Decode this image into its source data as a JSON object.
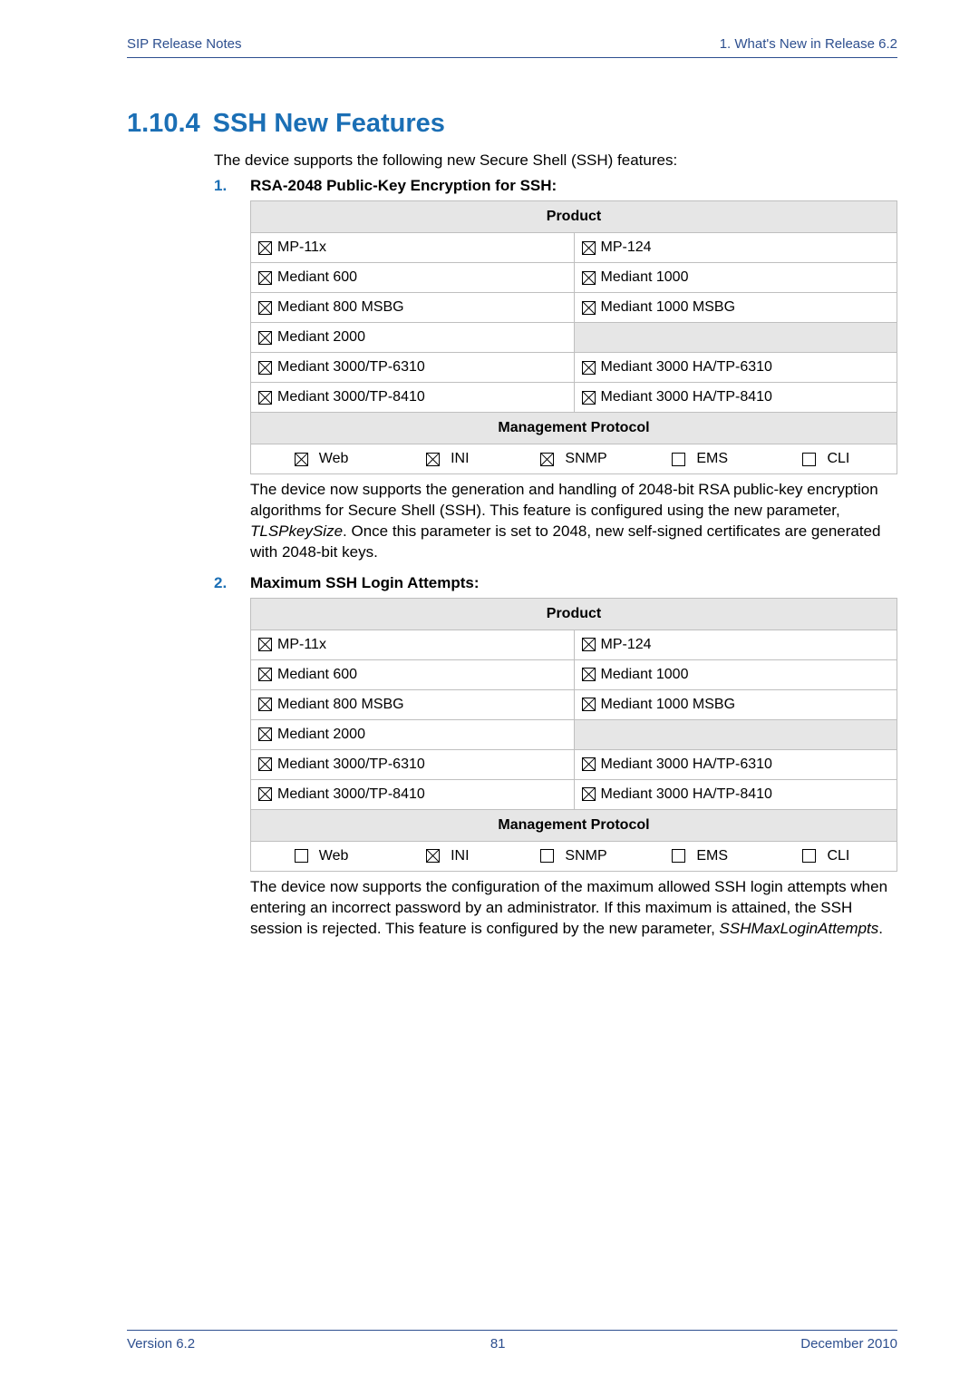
{
  "header": {
    "left": "SIP Release Notes",
    "right": "1. What's New in Release 6.2"
  },
  "section": {
    "number": "1.10.4",
    "title": "SSH New Features",
    "intro": "The device supports the following new Secure Shell (SSH) features:"
  },
  "item1": {
    "num": "1.",
    "title": "RSA-2048 Public-Key Encryption for SSH:",
    "productHeader": "Product",
    "mgmtHeader": "Management Protocol",
    "rows": [
      {
        "l": "MP-11x",
        "lc": true,
        "r": "MP-124",
        "rc": true
      },
      {
        "l": "Mediant 600",
        "lc": true,
        "r": "Mediant 1000",
        "rc": true
      },
      {
        "l": "Mediant 800 MSBG",
        "lc": true,
        "r": "Mediant 1000 MSBG",
        "rc": true
      },
      {
        "l": "Mediant 2000",
        "lc": true,
        "r": "",
        "rc": null
      },
      {
        "l": "Mediant 3000/TP-6310",
        "lc": true,
        "r": "Mediant 3000 HA/TP-6310",
        "rc": true
      },
      {
        "l": "Mediant 3000/TP-8410",
        "lc": true,
        "r": "Mediant 3000 HA/TP-8410",
        "rc": true
      }
    ],
    "mgmt": [
      {
        "label": "Web",
        "c": true
      },
      {
        "label": "INI",
        "c": true
      },
      {
        "label": "SNMP",
        "c": true
      },
      {
        "label": "EMS",
        "c": false
      },
      {
        "label": "CLI",
        "c": false
      }
    ],
    "para": "The device now supports the generation and handling of 2048-bit RSA public-key encryption algorithms for Secure Shell (SSH). This feature is configured using the new parameter, <i>TLSPkeySize</i>. Once this parameter is set to 2048, new self-signed certificates are generated with 2048-bit keys."
  },
  "item2": {
    "num": "2.",
    "title": "Maximum SSH Login Attempts:",
    "productHeader": "Product",
    "mgmtHeader": "Management Protocol",
    "rows": [
      {
        "l": "MP-11x",
        "lc": true,
        "r": "MP-124",
        "rc": true
      },
      {
        "l": "Mediant 600",
        "lc": true,
        "r": "Mediant 1000",
        "rc": true
      },
      {
        "l": "Mediant 800 MSBG",
        "lc": true,
        "r": "Mediant 1000 MSBG",
        "rc": true
      },
      {
        "l": "Mediant 2000",
        "lc": true,
        "r": "",
        "rc": null
      },
      {
        "l": "Mediant 3000/TP-6310",
        "lc": true,
        "r": "Mediant 3000 HA/TP-6310",
        "rc": true
      },
      {
        "l": "Mediant 3000/TP-8410",
        "lc": true,
        "r": "Mediant 3000 HA/TP-8410",
        "rc": true
      }
    ],
    "mgmt": [
      {
        "label": "Web",
        "c": false
      },
      {
        "label": "INI",
        "c": true
      },
      {
        "label": "SNMP",
        "c": false
      },
      {
        "label": "EMS",
        "c": false
      },
      {
        "label": "CLI",
        "c": false
      }
    ],
    "para": "The device now supports the configuration of the maximum allowed SSH login attempts when entering an incorrect password by an administrator. If this maximum is attained, the SSH session is rejected. This feature is configured by the new parameter, <i>SSHMaxLoginAttempts</i>."
  },
  "footer": {
    "left": "Version 6.2",
    "center": "81",
    "right": "December 2010"
  }
}
